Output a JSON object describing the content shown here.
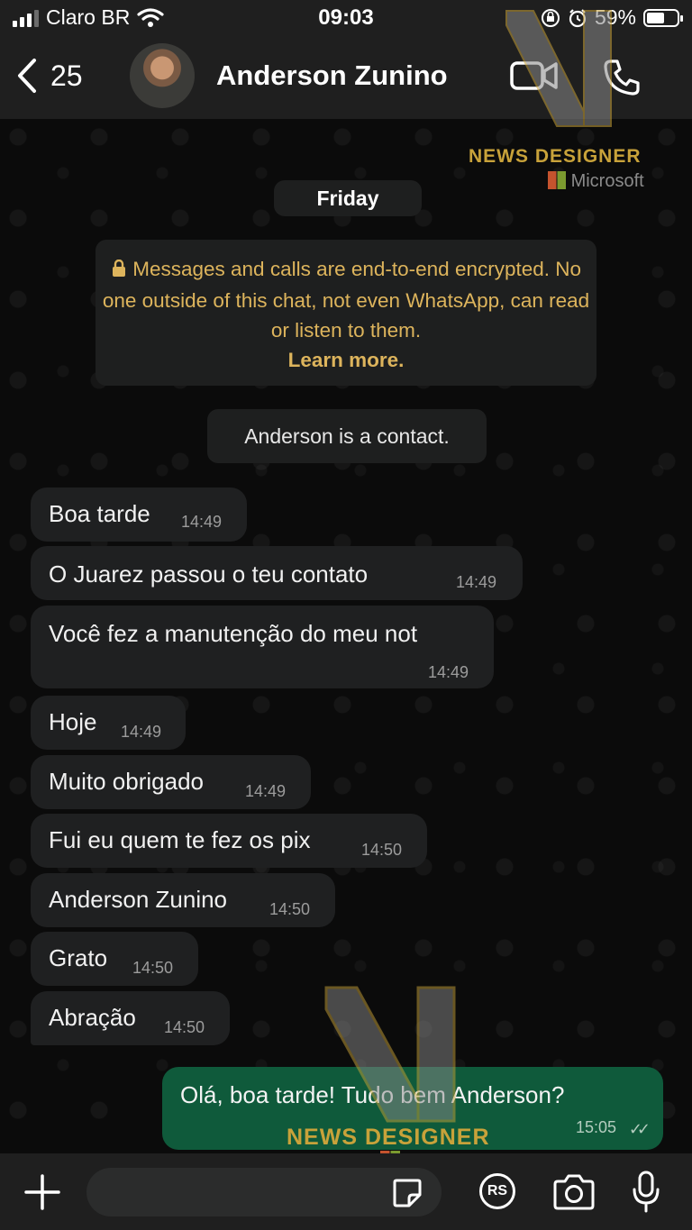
{
  "status_bar": {
    "carrier": "Claro BR",
    "time": "09:03",
    "battery": "59%",
    "battery_level": 0.59
  },
  "header": {
    "back_count": "25",
    "contact_name": "Anderson Zunino"
  },
  "chat": {
    "date_label": "Friday",
    "encryption_notice": "Messages and calls are end-to-end encrypted. No one outside of this chat, not even WhatsApp, can read or listen to them.",
    "learn_more": "Learn more.",
    "contact_notice": "Anderson is a contact.",
    "incoming": [
      {
        "text": "Boa tarde",
        "time": "14:49"
      },
      {
        "text": "O Juarez passou o teu contato",
        "time": "14:49"
      },
      {
        "text": "Você fez a manutenção  do meu not",
        "time": "14:49"
      },
      {
        "text": "Hoje",
        "time": "14:49"
      },
      {
        "text": "Muito obrigado",
        "time": "14:49"
      },
      {
        "text": "Fui eu quem te fez os pix",
        "time": "14:50"
      },
      {
        "text": "Anderson Zunino",
        "time": "14:50"
      },
      {
        "text": "Grato",
        "time": "14:50"
      },
      {
        "text": "Abração",
        "time": "14:50"
      }
    ],
    "outgoing": [
      {
        "text": "Olá, boa tarde! Tudo bem Anderson?",
        "time": "15:05"
      }
    ]
  },
  "watermark": {
    "brand": "NEWS DESIGNER",
    "partner": "Microsoft"
  },
  "composer": {
    "sticker_label": "RS"
  },
  "colors": {
    "outgoing_bubble": "#0f5a3b",
    "incoming_bubble": "#1f2021",
    "notice_text": "#ddb45c"
  }
}
